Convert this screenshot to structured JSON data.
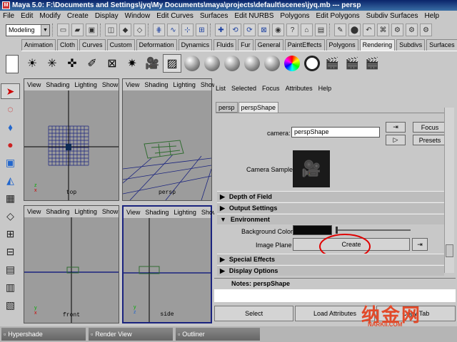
{
  "window": {
    "title": "Maya 5.0: F:\\Documents and Settings\\jyq\\My Documents\\maya\\projects\\default\\scenes\\jyq.mb  ---  persp",
    "logo": "M"
  },
  "menubar": [
    "File",
    "Edit",
    "Modify",
    "Create",
    "Display",
    "Window",
    "Edit Curves",
    "Surfaces",
    "Edit NURBS",
    "Polygons",
    "Edit Polygons",
    "Subdiv Surfaces",
    "Help"
  ],
  "toolbar": {
    "mode_select": "Modeling",
    "icons": [
      "new-scene-icon",
      "open-scene-icon",
      "save-scene-icon",
      "select-hierarchy-icon",
      "select-object-icon",
      "select-component-icon",
      "snap-grid-icon",
      "snap-curve-icon",
      "snap-point-icon",
      "snap-plane-icon",
      "history-icon",
      "render-icon",
      "ipr-icon",
      "render-globals-icon",
      "show-manipulator-icon",
      "channel-box-icon",
      "attribute-editor-icon",
      "tool-settings-icon",
      "layout-icon"
    ]
  },
  "shelf_tabs": [
    "Animation",
    "Cloth",
    "Curves",
    "Custom",
    "Deformation",
    "Dynamics",
    "Fluids",
    "Fur",
    "General",
    "PaintEffects",
    "Polygons",
    "Rendering",
    "Subdivs",
    "Surfaces"
  ],
  "shelf_active": "Rendering",
  "viewports": [
    {
      "name": "top",
      "menus": [
        "View",
        "Shading",
        "Lighting",
        "Show"
      ]
    },
    {
      "name": "persp",
      "menus": [
        "View",
        "Shading",
        "Lighting",
        "Show"
      ]
    },
    {
      "name": "front",
      "menus": [
        "View",
        "Shading",
        "Lighting",
        "Show"
      ]
    },
    {
      "name": "side",
      "menus": [
        "View",
        "Shading",
        "Lighting",
        "Show"
      ]
    }
  ],
  "axis_labels": {
    "x": "x",
    "y": "y",
    "z": "z"
  },
  "attr_editor": {
    "menus": [
      "List",
      "Selected",
      "Focus",
      "Attributes",
      "Help"
    ],
    "tabs": [
      "persp",
      "perspShape"
    ],
    "active_tab": "perspShape",
    "camera_label": "camera:",
    "camera_value": "perspShape",
    "focus_btn": "Focus",
    "presets_btn": "Presets",
    "camera_sample_label": "Camera Sample",
    "sections": [
      "Depth of Field",
      "Output Settings",
      "Environment",
      "Special Effects",
      "Display Options"
    ],
    "bg_color_label": "Background Color",
    "bg_color": "#0a0a0a",
    "image_plane_label": "Image Plane",
    "create_btn": "Create",
    "notes_label": "Notes:  perspShape",
    "select_btn": "Select",
    "load_attrs_btn": "Load Attributes",
    "copy_tab_btn": "Copy Tab"
  },
  "taskbar": [
    "Hypershade",
    "Render View",
    "Outliner"
  ],
  "watermark": {
    "main": "纳金网",
    "sub": "NARKII.COM"
  },
  "colors": {
    "titlebar": "#0a246a",
    "grid": "#1a237e",
    "highlight": "#1a237e",
    "annotation": "#e00000",
    "watermark": "#e24a2a"
  }
}
